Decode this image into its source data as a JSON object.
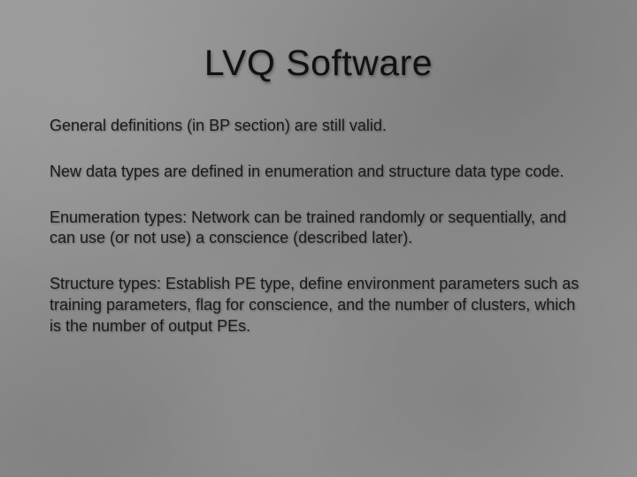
{
  "slide": {
    "title": "LVQ Software",
    "paragraphs": [
      "General definitions (in BP section) are still valid.",
      "New data types are defined in enumeration and structure data type code.",
      "Enumeration types: Network can be trained randomly or sequentially, and can use (or not use) a conscience (described later).",
      "Structure types: Establish PE type, define environment parameters such as training parameters, flag for conscience, and the number of clusters, which is the number of output PEs."
    ]
  }
}
